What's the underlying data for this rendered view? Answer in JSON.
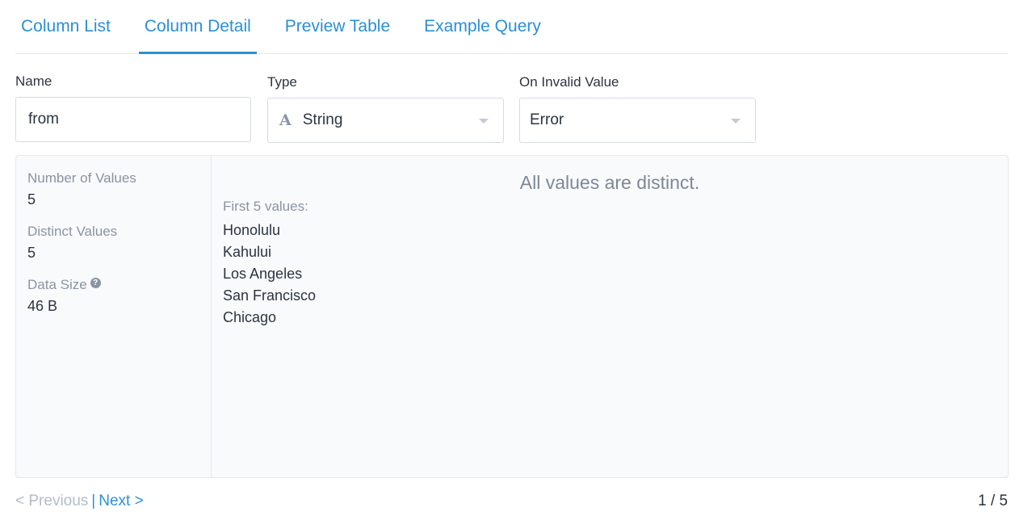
{
  "tabs": [
    {
      "label": "Column List",
      "active": false
    },
    {
      "label": "Column Detail",
      "active": true
    },
    {
      "label": "Preview Table",
      "active": false
    },
    {
      "label": "Example Query",
      "active": false
    }
  ],
  "form": {
    "name_label": "Name",
    "name_value": "from",
    "type_label": "Type",
    "type_icon": "A",
    "type_value": "String",
    "invalid_label": "On Invalid Value",
    "invalid_value": "Error"
  },
  "stats": {
    "count_label": "Number of Values",
    "count_value": "5",
    "distinct_label": "Distinct Values",
    "distinct_value": "5",
    "size_label": "Data Size",
    "size_help": "?",
    "size_value": "46 B"
  },
  "detail": {
    "message": "All values are distinct.",
    "first_label": "First 5 values:",
    "values": [
      "Honolulu",
      "Kahului",
      "Los Angeles",
      "San Francisco",
      "Chicago"
    ]
  },
  "pager": {
    "prev_label": "< Previous",
    "separator": "|",
    "next_label": "Next >",
    "page_count": "1 / 5"
  },
  "colors": {
    "accent": "#2b8fd6",
    "muted": "#8a94a3"
  }
}
